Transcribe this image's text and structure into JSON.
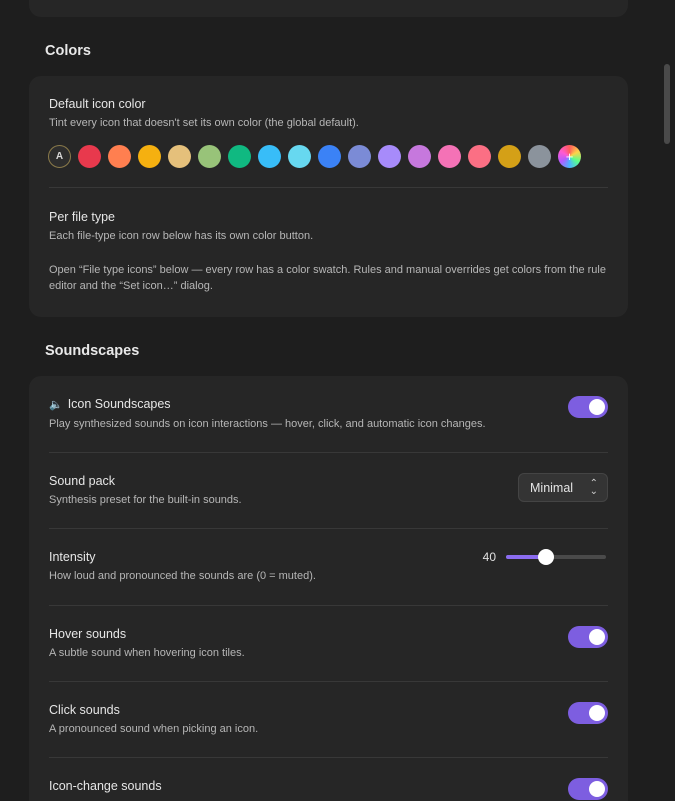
{
  "colors_section": {
    "title": "Colors",
    "default_icon_color": {
      "title": "Default icon color",
      "description": "Tint every icon that doesn't set its own color (the global default).",
      "auto_label": "A",
      "custom_label": "+",
      "swatches": [
        "#e8394d",
        "#ff7f50",
        "#f5b010",
        "#e5c07b",
        "#98c379",
        "#10b981",
        "#38bdf8",
        "#67d8f0",
        "#3b82f6",
        "#7b8bd6",
        "#a78bfa",
        "#c678dd",
        "#f472b6",
        "#fb6f84",
        "#d4a017",
        "#8b939c"
      ]
    },
    "per_file_type": {
      "title": "Per file type",
      "description": "Each file-type icon row below has its own color button.",
      "note": "Open “File type icons” below — every row has a color swatch. Rules and manual overrides get colors from the rule editor and the “Set icon…” dialog."
    }
  },
  "soundscapes_section": {
    "title": "Soundscapes",
    "icon_soundscapes": {
      "icon": "🔈",
      "title": "Icon Soundscapes",
      "description": "Play synthesized sounds on icon interactions — hover, click, and automatic icon changes.",
      "enabled": true
    },
    "sound_pack": {
      "title": "Sound pack",
      "description": "Synthesis preset for the built-in sounds.",
      "value": "Minimal"
    },
    "intensity": {
      "title": "Intensity",
      "description": "How loud and pronounced the sounds are (0 = muted).",
      "value": 40,
      "display_value": "40",
      "min": 0,
      "max": 100
    },
    "hover_sounds": {
      "title": "Hover sounds",
      "description": "A subtle sound when hovering icon tiles.",
      "enabled": true
    },
    "click_sounds": {
      "title": "Click sounds",
      "description": "A pronounced sound when picking an icon.",
      "enabled": true
    },
    "icon_change_sounds": {
      "title": "Icon-change sounds",
      "enabled": true
    }
  }
}
